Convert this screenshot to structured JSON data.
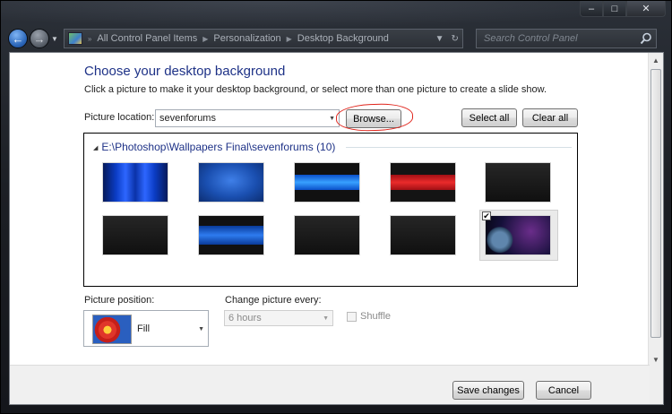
{
  "window": {
    "caption_buttons": [
      "minimize",
      "maximize",
      "close"
    ]
  },
  "addressbar": {
    "crumbs": [
      "All Control Panel Items",
      "Personalization",
      "Desktop Background"
    ],
    "search_placeholder": "Search Control Panel"
  },
  "page": {
    "heading": "Choose your desktop background",
    "subtext": "Click a picture to make it your desktop background, or select more than one picture to create a slide show."
  },
  "location": {
    "label": "Picture location:",
    "value": "sevenforums",
    "browse_label": "Browse...",
    "select_all_label": "Select all",
    "clear_all_label": "Clear all"
  },
  "gallery": {
    "group_title": "E:\\Photoshop\\Wallpapers Final\\sevenforums (10)",
    "thumbnails": [
      {
        "name": "wallpaper-1",
        "style": "blue-waves",
        "selected": false
      },
      {
        "name": "wallpaper-2",
        "style": "blue-text",
        "selected": false
      },
      {
        "name": "wallpaper-3",
        "style": "blue-band",
        "selected": false
      },
      {
        "name": "wallpaper-4",
        "style": "red-band",
        "selected": false
      },
      {
        "name": "wallpaper-5",
        "style": "dark",
        "selected": false
      },
      {
        "name": "wallpaper-6",
        "style": "dark",
        "selected": false
      },
      {
        "name": "wallpaper-7",
        "style": "blue-stripe",
        "selected": false
      },
      {
        "name": "wallpaper-8",
        "style": "dark",
        "selected": false
      },
      {
        "name": "wallpaper-9",
        "style": "dark",
        "selected": false
      },
      {
        "name": "wallpaper-10",
        "style": "planet",
        "selected": true
      }
    ]
  },
  "position": {
    "label": "Picture position:",
    "value": "Fill"
  },
  "change": {
    "label": "Change picture every:",
    "value": "6 hours",
    "shuffle_label": "Shuffle"
  },
  "footer": {
    "save_label": "Save changes",
    "cancel_label": "Cancel"
  },
  "colors": {
    "heading": "#1e3287",
    "annotation_circle": "#e0241b"
  }
}
